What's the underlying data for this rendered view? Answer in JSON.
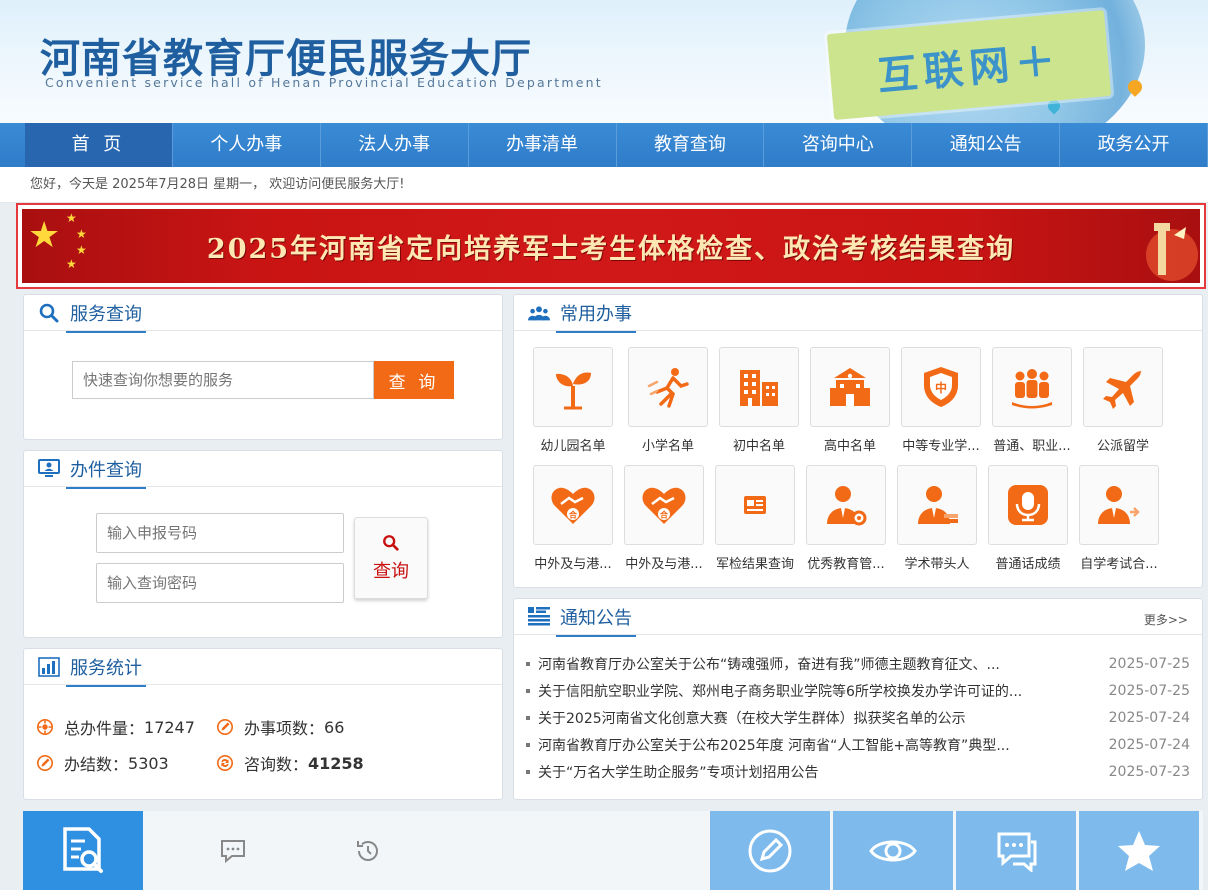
{
  "header": {
    "title": "河南省教育厅便民服务大厅",
    "subtitle": "Convenient service hall of Henan Provincial Education Department",
    "badge": "互联网＋"
  },
  "nav": {
    "items": [
      "首 页",
      "个人办事",
      "法人办事",
      "办事清单",
      "教育查询",
      "咨询中心",
      "通知公告",
      "政务公开"
    ]
  },
  "welcome": "您好，今天是 2025年7月28日 星期一， 欢迎访问便民服务大厅!",
  "banner": {
    "text": "2025年河南省定向培养军士考生体格检查、政治考核结果查询"
  },
  "service_search": {
    "title": "服务查询",
    "placeholder": "快速查询你想要的服务",
    "button": "查 询"
  },
  "case_search": {
    "title": "办件查询",
    "number_placeholder": "输入申报号码",
    "password_placeholder": "输入查询密码",
    "button": "查询"
  },
  "stats": {
    "title": "服务统计",
    "total_label": "总办件量：",
    "total_value": "17247",
    "items_label": "办事项数：",
    "items_value": "66",
    "done_label": "办结数：",
    "done_value": "5303",
    "consult_label": "咨询数：",
    "consult_value": "41258"
  },
  "common_services": {
    "title": "常用办事",
    "row1": [
      {
        "label": "幼儿园名单",
        "icon": "sprout-icon"
      },
      {
        "label": "小学名单",
        "icon": "running-kid-icon"
      },
      {
        "label": "初中名单",
        "icon": "buildings-icon"
      },
      {
        "label": "高中名单",
        "icon": "school-building-icon"
      },
      {
        "label": "中等专业学...",
        "icon": "shield-badge-icon"
      },
      {
        "label": "普通、职业...",
        "icon": "people-group-icon"
      },
      {
        "label": "公派留学",
        "icon": "airplane-icon"
      }
    ],
    "row2": [
      {
        "label": "中外及与港...",
        "icon": "handshake-heart-icon"
      },
      {
        "label": "中外及与港...",
        "icon": "handshake-heart-icon"
      },
      {
        "label": "军检结果查询",
        "icon": "id-card-icon"
      },
      {
        "label": "优秀教育管...",
        "icon": "manager-gear-icon"
      },
      {
        "label": "学术带头人",
        "icon": "leader-books-icon"
      },
      {
        "label": "普通话成绩",
        "icon": "microphone-icon"
      },
      {
        "label": "自学考试合...",
        "icon": "person-arrow-icon"
      }
    ]
  },
  "notices": {
    "title": "通知公告",
    "more": "更多>>",
    "items": [
      {
        "title": "河南省教育厅办公室关于公布“铸魂强师，奋进有我”师德主题教育征文、...",
        "date": "2025-07-25"
      },
      {
        "title": "关于信阳航空职业学院、郑州电子商务职业学院等6所学校换发办学许可证的...",
        "date": "2025-07-25"
      },
      {
        "title": "关于2025河南省文化创意大赛（在校大学生群体）拟获奖名单的公示",
        "date": "2025-07-24"
      },
      {
        "title": "河南省教育厅办公室关于公布2025年度 河南省“人工智能+高等教育”典型...",
        "date": "2025-07-24"
      },
      {
        "title": "关于“万名大学生助企服务”专项计划招用公告",
        "date": "2025-07-23"
      }
    ]
  },
  "colors": {
    "nav_blue": "#2f7cc9",
    "accent_orange": "#f26a16",
    "banner_red": "#c91414",
    "title_blue": "#1f5f9f"
  }
}
